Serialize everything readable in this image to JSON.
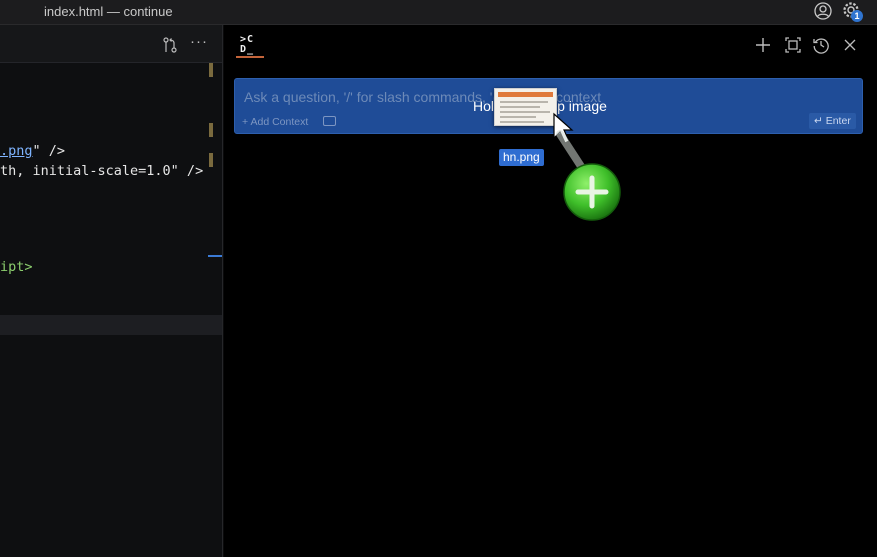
{
  "window": {
    "title": "index.html — continue"
  },
  "titlebar": {
    "icons": [
      "account-icon",
      "gear-icon"
    ],
    "notification_count": "1"
  },
  "editor": {
    "toolbar_icons": [
      "source-control-icon",
      "more-icon"
    ],
    "more_label": "···",
    "code_lines": [
      {
        "link": ".png",
        "rest": "\" />"
      },
      {
        "text": "th, initial-scale=1.0\" />"
      },
      {
        "tag": "ipt>"
      }
    ]
  },
  "chat_panel": {
    "logo_top": ">C",
    "logo_bottom": "D_",
    "actions": [
      "new-chat-icon",
      "fullscreen-icon",
      "history-icon",
      "close-icon"
    ],
    "input": {
      "placeholder": "Ask a question, '/' for slash commands, '@' to add context",
      "drop_hint": "Hold ⇧ to drop image",
      "add_context_label": "+ Add Context",
      "enter_label": "↵ Enter"
    }
  },
  "drag": {
    "filename": "hn.png"
  },
  "colors": {
    "accent_orange": "#c4643a",
    "input_blue": "#1f4c97",
    "badge_blue": "#2f74d0",
    "plus_green": "#3fbf2a"
  }
}
